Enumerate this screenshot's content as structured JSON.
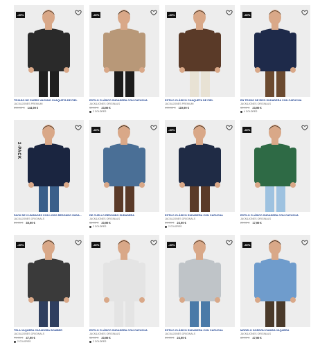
{
  "products": [
    {
      "badge": "-40%",
      "name": "TEJADO DE CUERO VACUNO CHAQUETA DE PIEL",
      "brand": "JACK&JONES PREMIUM",
      "old_price": "239,99 €",
      "price": "144,99 €",
      "colors": "",
      "garment": "#2a2a2a",
      "pants": "#1f1f1f",
      "skin": "#d9a888",
      "hair": "#4a3525"
    },
    {
      "badge": "-40%",
      "name": "ESTILO CLÁSICO SUDADERA CON CAPUCHA",
      "brand": "JACK&JONES ORIGINALS",
      "old_price": "39,99 €",
      "price": "23,99 €",
      "colors": "2 COLORES",
      "garment": "#b89878",
      "pants": "#1c1c1c",
      "skin": "#d9a888",
      "hair": "#2e2418"
    },
    {
      "badge": "-40%",
      "name": "ESTILO CLÁSICO CHAQUETA DE PIEL",
      "brand": "JACK&JONES PREMIUM",
      "old_price": "199,99 €",
      "price": "119,99 €",
      "colors": "",
      "garment": "#5a3a28",
      "pants": "#e8e2d4",
      "skin": "#d9a888",
      "hair": "#3a2a1e"
    },
    {
      "badge": "-40%",
      "name": "EN TEJIDO DE RIZO SUDADERA CON CAPUCHA",
      "brand": "JACK&JONES ORIGINALS",
      "old_price": "39,99 €",
      "price": "23,99 €",
      "colors": "4 COLORES",
      "garment": "#1e2a4a",
      "pants": "#6b4a30",
      "skin": "#d9a888",
      "hair": "#5a4028"
    },
    {
      "badge": "",
      "name": "PACK DE 2 UNIDADES CON LOGO REDONDO SUDA...",
      "brand": "JACK&JONES ORIGINALS",
      "old_price": "59,99 €",
      "price": "35,99 €",
      "colors": "",
      "garment": "#1a2540",
      "pants": "#3a5f8a",
      "skin": "#d9a888",
      "hair": "#4a3525",
      "pack": "2-PACK"
    },
    {
      "badge": "-40%",
      "name": "DE CUELLO REDONDO SUDADERA",
      "brand": "JACK&JONES ORIGINALS",
      "old_price": "34,99 €",
      "price": "20,99 €",
      "colors": "2 COLORES",
      "garment": "#4a6f96",
      "pants": "#5a3a28",
      "skin": "#d9a888",
      "hair": "#2e2418"
    },
    {
      "badge": "-40%",
      "name": "ESTILO CLÁSICO SUDADERA CON CAPUCHA",
      "brand": "JACK&JONES ORIGINALS",
      "old_price": "39,99 €",
      "price": "23,99 €",
      "colors": "2 COLORES",
      "garment": "#1f2b45",
      "pants": "#5a3a28",
      "skin": "#d9a888",
      "hair": "#3a2a1e"
    },
    {
      "badge": "-40%",
      "name": "ESTILO CLÁSICO SUDADERA CON CAPUCHA",
      "brand": "JACK&JONES ORIGINALS",
      "old_price": "29,99 €",
      "price": "17,99 €",
      "colors": "",
      "garment": "#2e6a45",
      "pants": "#9ec2e0",
      "skin": "#d9a888",
      "hair": "#4a3525"
    },
    {
      "badge": "-40%",
      "name": "TELA VAQUERA CAZADORA BOMBER",
      "brand": "JACK&JONES ORIGINALS",
      "old_price": "79,99 €",
      "price": "47,99 €",
      "colors": "2 COLORES",
      "garment": "#3a3a3a",
      "pants": "#2f3f5f",
      "skin": "#d9a888",
      "hair": "#2e2418"
    },
    {
      "badge": "-40%",
      "name": "ESTILO CLÁSICO SUDADERA CON CAPUCHA",
      "brand": "JACK&JONES ORIGINALS",
      "old_price": "34,99 €",
      "price": "20,99 €",
      "colors": "2 COLORES",
      "garment": "#e4e4e4",
      "pants": "#e4e4e4",
      "skin": "#d9a888",
      "hair": "#4a2e1a"
    },
    {
      "badge": "-40%",
      "name": "ESTILO CLÁSICO SUDADERA CON CAPUCHA",
      "brand": "JACK&JONES ORIGINALS",
      "old_price": "39,99 €",
      "price": "23,99 €",
      "colors": "",
      "garment": "#bfc4c8",
      "pants": "#4a7aa8",
      "skin": "#d9a888",
      "hair": "#4a3525"
    },
    {
      "badge": "-30%",
      "name": "MODELO GORDON CAMISA VAQUERA",
      "brand": "JACK&JONES ORIGINALS",
      "old_price": "69,99 €",
      "price": "47,99 €",
      "colors": "",
      "garment": "#6f9ccc",
      "pants": "#4a3a2a",
      "skin": "#d9a888",
      "hair": "#3a2a1e"
    }
  ]
}
